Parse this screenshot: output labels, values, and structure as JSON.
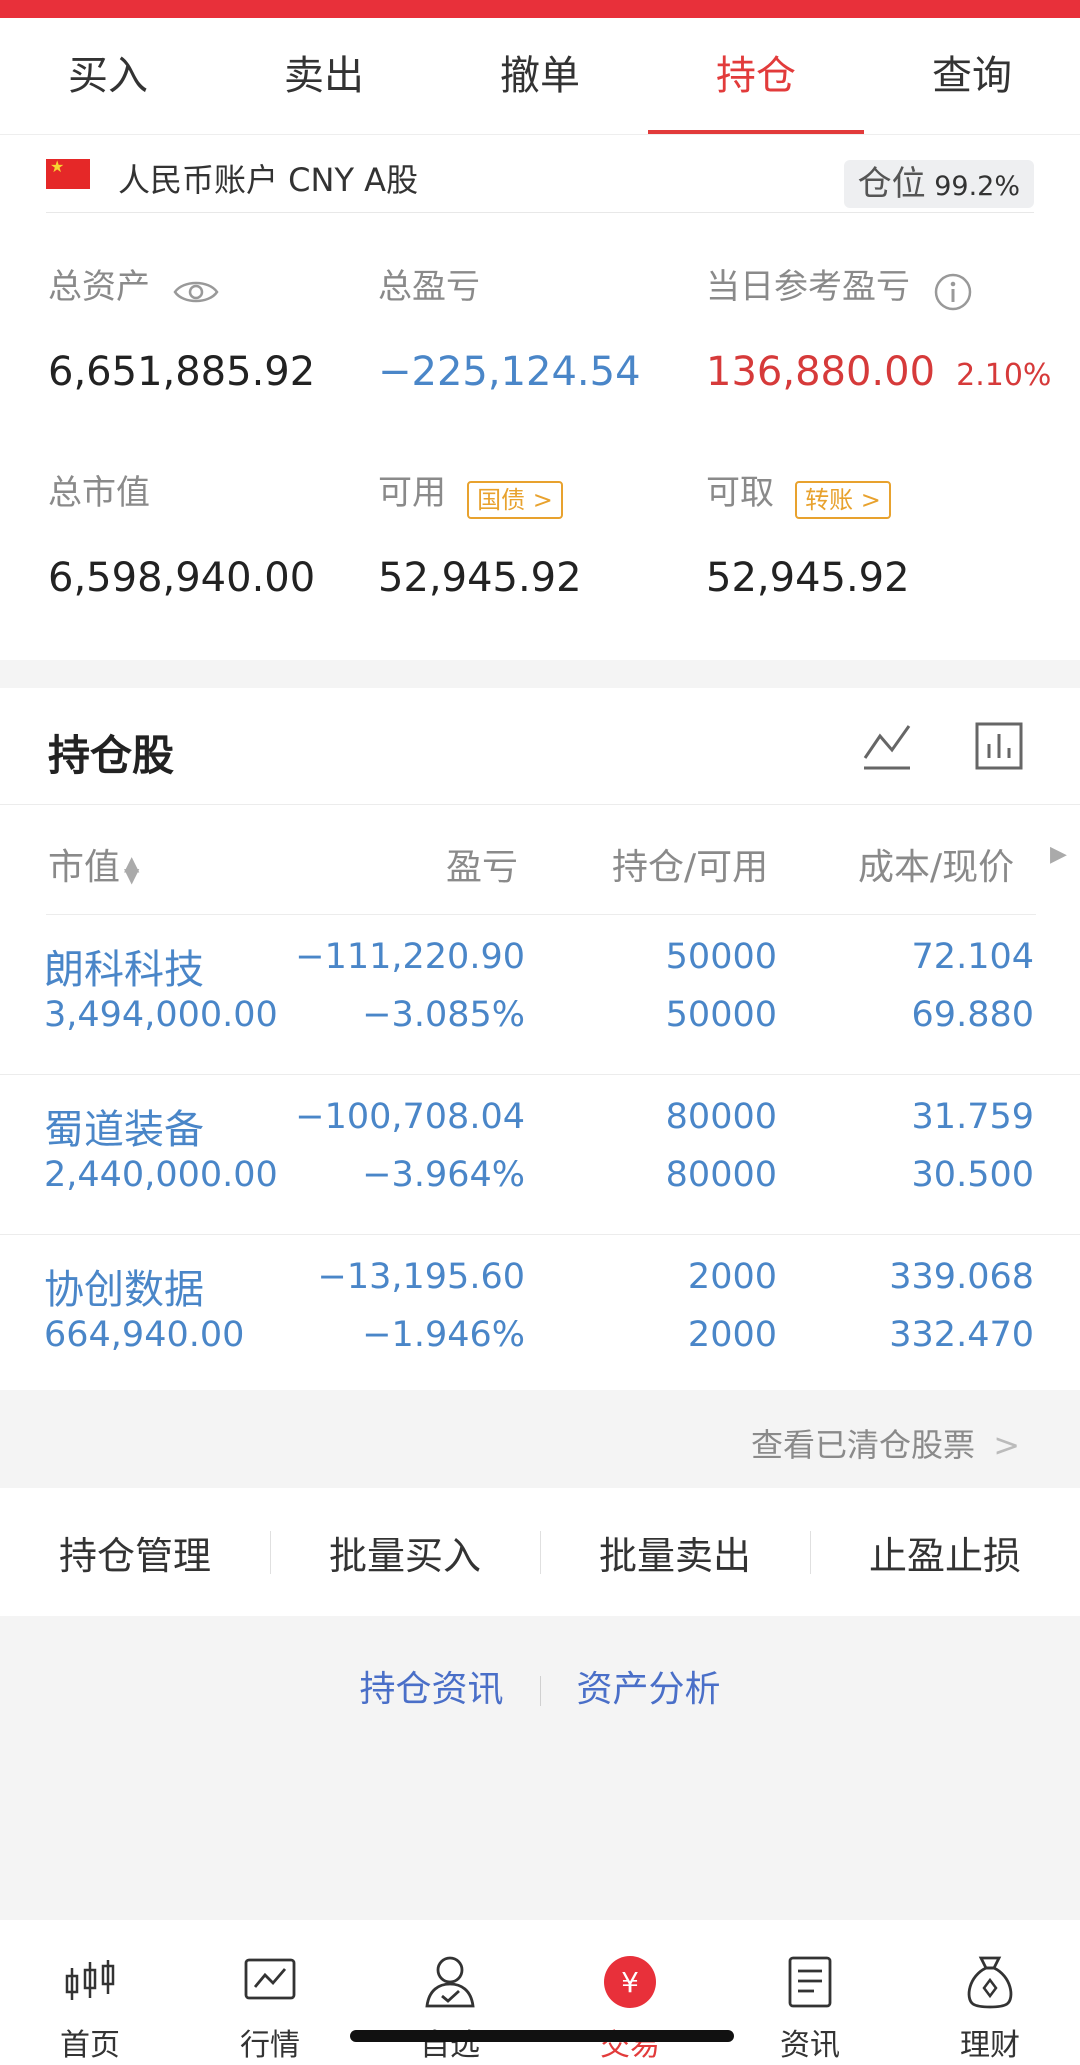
{
  "tabs": [
    "买入",
    "卖出",
    "撤单",
    "持仓",
    "查询"
  ],
  "active_tab": "持仓",
  "account": {
    "label": "人民币账户 CNY A股",
    "position_label": "仓位",
    "position_value": "99.2%"
  },
  "summary": {
    "total_assets_label": "总资产",
    "total_assets": "6,651,885.92",
    "total_pnl_label": "总盈亏",
    "total_pnl": "−225,124.54",
    "daily_pnl_label": "当日参考盈亏",
    "daily_pnl": "136,880.00",
    "daily_pnl_pct": "2.10%",
    "market_value_label": "总市值",
    "market_value": "6,598,940.00",
    "available_label": "可用",
    "available_tag": "国债",
    "available": "52,945.92",
    "withdrawable_label": "可取",
    "withdrawable_tag": "转账",
    "withdrawable": "52,945.92"
  },
  "holdings": {
    "title": "持仓股",
    "columns": [
      "市值",
      "盈亏",
      "持仓/可用",
      "成本/现价"
    ],
    "rows": [
      {
        "name": "朗科科技",
        "market_value": "3,494,000.00",
        "pnl": "−111,220.90",
        "pnl_pct": "−3.085%",
        "position": "50000",
        "available": "50000",
        "cost": "72.104",
        "price": "69.880"
      },
      {
        "name": "蜀道装备",
        "market_value": "2,440,000.00",
        "pnl": "−100,708.04",
        "pnl_pct": "−3.964%",
        "position": "80000",
        "available": "80000",
        "cost": "31.759",
        "price": "30.500"
      },
      {
        "name": "协创数据",
        "market_value": "664,940.00",
        "pnl": "−13,195.60",
        "pnl_pct": "−1.946%",
        "position": "2000",
        "available": "2000",
        "cost": "339.068",
        "price": "332.470"
      }
    ]
  },
  "cleared_link": "查看已清仓股票",
  "actions": [
    "持仓管理",
    "批量买入",
    "批量卖出",
    "止盈止损"
  ],
  "links": [
    "持仓资讯",
    "资产分析"
  ],
  "bottom_nav": [
    {
      "label": "首页",
      "icon": "candlestick-icon"
    },
    {
      "label": "行情",
      "icon": "chart-monitor-icon"
    },
    {
      "label": "自选",
      "icon": "person-check-icon"
    },
    {
      "label": "交易",
      "icon": "yen-coin-icon"
    },
    {
      "label": "资讯",
      "icon": "document-icon"
    },
    {
      "label": "理财",
      "icon": "money-bag-icon"
    }
  ],
  "bottom_nav_active": "交易",
  "colors": {
    "accent_red": "#e23b3b",
    "link_blue": "#4a86c8",
    "tag_orange": "#e8a22e"
  }
}
